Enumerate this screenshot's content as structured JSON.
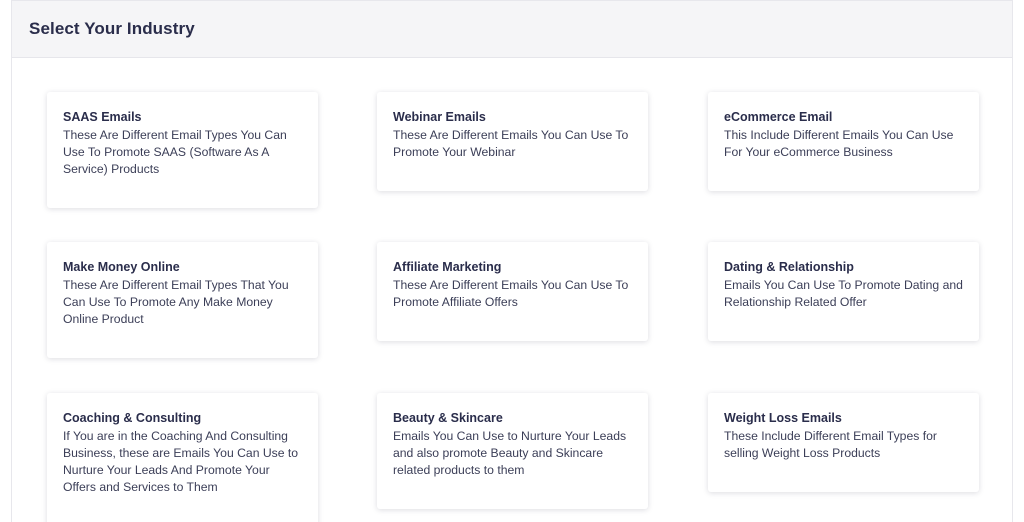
{
  "header": {
    "title": "Select Your Industry"
  },
  "industries": [
    {
      "title": "SAAS Emails",
      "description": "These Are Different Email Types You Can Use To Promote SAAS (Software As A Service) Products"
    },
    {
      "title": "Webinar Emails",
      "description": "These Are Different Emails You Can Use To Promote Your Webinar"
    },
    {
      "title": "eCommerce Email",
      "description": "This Include Different Emails You Can Use For Your eCommerce Business"
    },
    {
      "title": "Make Money Online",
      "description": "These Are Different Email Types That You Can Use To Promote Any Make Money Online Product"
    },
    {
      "title": "Affiliate Marketing",
      "description": "These Are Different Emails You Can Use To Promote Affiliate Offers"
    },
    {
      "title": "Dating & Relationship",
      "description": "Emails You Can Use To Promote Dating and Relationship Related Offer"
    },
    {
      "title": "Coaching & Consulting",
      "description": "If You are in the Coaching And Consulting Business, these are Emails You Can Use to Nurture Your Leads And Promote Your Offers and Services to Them"
    },
    {
      "title": "Beauty & Skincare",
      "description": "Emails You Can Use to Nurture Your Leads and also promote Beauty and Skincare related products to them"
    },
    {
      "title": "Weight Loss Emails",
      "description": "These Include Different Email Types for selling Weight Loss Products"
    }
  ]
}
